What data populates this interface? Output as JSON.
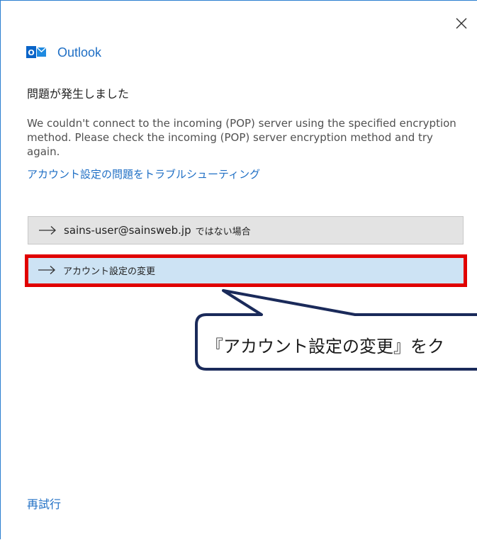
{
  "window": {
    "app_name": "Outlook",
    "close_icon": "close-icon",
    "border_color": "#2b7fd0"
  },
  "dialog": {
    "title": "問題が発生しました",
    "message": "We couldn't connect to the incoming (POP) server using the specified encryption method. Please check the incoming (POP) server encryption method and try again.",
    "troubleshoot_link": "アカウント設定の問題をトラブルシューティング",
    "options": [
      {
        "icon": "arrow-right-icon",
        "email": "sains-user@sainsweb.jp",
        "suffix": "ではない場合"
      },
      {
        "icon": "arrow-right-icon",
        "label": "アカウント設定の変更",
        "selected": true
      }
    ],
    "retry_link": "再試行"
  },
  "annotation": {
    "callout_text": "『アカウント設定の変更』をク",
    "highlight_color": "#e00000",
    "callout_border_color": "#1a2a5a"
  },
  "colors": {
    "accent": "#1f6fc5",
    "option_bg": "#e3e3e3",
    "selected_bg": "#cde3f4"
  }
}
